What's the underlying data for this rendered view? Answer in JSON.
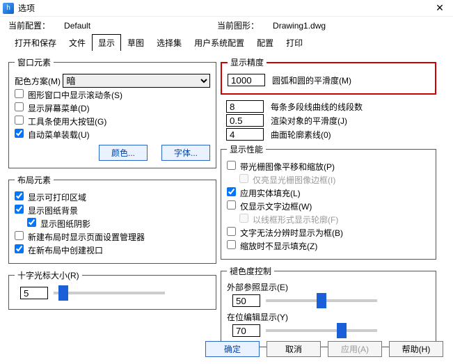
{
  "title": "选项",
  "config": {
    "current_label": "当前配置：",
    "current_value": "Default",
    "drawing_label": "当前图形：",
    "drawing_value": "Drawing1.dwg"
  },
  "tabs": [
    "打开和保存",
    "文件",
    "显示",
    "草图",
    "选择集",
    "用户系统配置",
    "配置",
    "打印"
  ],
  "tabs_active_index": 2,
  "window_elements": {
    "legend": "窗口元素",
    "scheme_label": "配色方案(M)",
    "scheme_value": "暗",
    "scrollbars": "图形窗口中显示滚动条(S)",
    "screen_menu": "显示屏幕菜单(D)",
    "large_toolbar_btns": "工具条使用大按钮(G)",
    "auto_menu_load": "自动菜单装载(U)",
    "btn_color": "颜色...",
    "btn_font": "字体..."
  },
  "layout_elements": {
    "legend": "布局元素",
    "printable_area": "显示可打印区域",
    "paper_bg": "显示图纸背景",
    "paper_shadow": "显示图纸阴影",
    "page_setup_on_new": "新建布局时显示页面设置管理器",
    "create_viewport": "在新布局中创建视口"
  },
  "crosshair": {
    "label": "十字光标大小(R)",
    "value": "5"
  },
  "display_precision": {
    "legend": "显示精度",
    "arc_value": "1000",
    "arc_label": "圆弧和圆的平滑度(M)",
    "poly_value": "8",
    "poly_label": "每条多段线曲线的线段数",
    "render_value": "0.5",
    "render_label": "渲染对象的平滑度(J)",
    "surface_value": "4",
    "surface_label": "曲面轮廓素线(0)"
  },
  "display_perf": {
    "legend": "显示性能",
    "pan_zoom_raster": "带光栅图像平移和缩放(P)",
    "highlight_raster_frame": "仅亮显光栅图像边框(I)",
    "solid_fill": "应用实体填充(L)",
    "text_frame_only": "仅显示文字边框(W)",
    "wireframe_silhouette": "以线框形式显示轮廓(F)",
    "true_type_as_frame": "文字无法分辨时显示为框(B)",
    "hide_fill_on_zoom": "缩放时不显示填充(Z)"
  },
  "fade_control": {
    "legend": "褪色度控制",
    "xref_label": "外部参照显示(E)",
    "xref_value": "50",
    "inplace_label": "在位编辑显示(Y)",
    "inplace_value": "70"
  },
  "footer": {
    "ok": "确定",
    "cancel": "取消",
    "apply": "应用(A)",
    "help": "帮助(H)"
  }
}
